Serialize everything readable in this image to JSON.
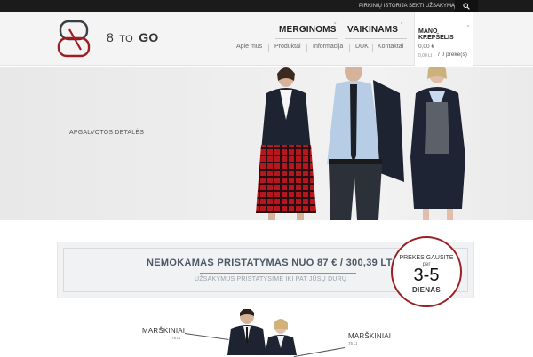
{
  "topbar": {
    "links": [
      "PIRKINIŲ ISTORIJA",
      "SEKTI UŽSAKYMĄ"
    ]
  },
  "logo": {
    "number": "8",
    "to": "TO",
    "go": "GO"
  },
  "nav": {
    "categories": [
      "MERGINOMS",
      "VAIKINAMS"
    ],
    "sub": [
      "Apie mus",
      "Produktai",
      "Informacija",
      "DUK",
      "Kontaktai"
    ]
  },
  "cart": {
    "title": "MANO KREPŠELIS",
    "total": "0,00 €",
    "sub_total": "0,00 Lt",
    "items": "/ 0 prekė(s)"
  },
  "hero": {
    "caption": "APGALVOTOS DETALĖS"
  },
  "promo": {
    "title": "NEMOKAMAS PRISTATYMAS NUO 87 € / 300,39 LT",
    "subtitle": "UŽSAKYMUS PRISTATYSIME IKI PAT JŪSŲ DURŲ"
  },
  "badge": {
    "line1": "PREKES GAUSITE",
    "line2": "per",
    "number": "3-5",
    "days": "DIENAS"
  },
  "products": [
    {
      "label": "MARŠKINIAI",
      "price": "75 Lt"
    },
    {
      "label": "MARŠKINIAI",
      "price": "75 Lt"
    }
  ],
  "colors": {
    "accent": "#9a1e22",
    "topbar": "#1b1b1b",
    "promo_text": "#4c5866"
  }
}
